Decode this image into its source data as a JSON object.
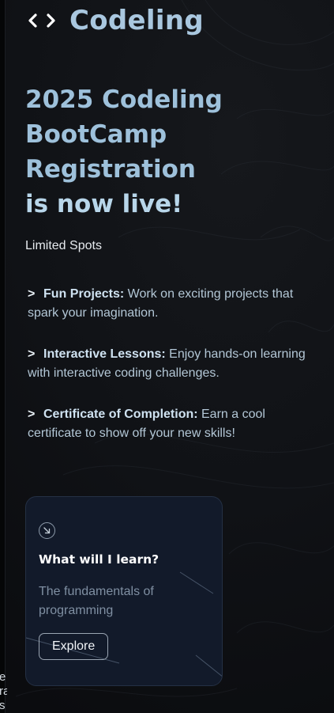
{
  "brand": {
    "icon": "code-brackets-icon",
    "name": "Codeling"
  },
  "hero": {
    "line1": "2025 Codeling",
    "line2": "BootCamp",
    "line3": "Registration",
    "line4": "is now live!"
  },
  "limited_text": "Limited Spots",
  "features": [
    {
      "title": "Fun Projects:",
      "desc": " Work on exciting projects that spark your imagination."
    },
    {
      "title": "Interactive Lessons:",
      "desc": " Enjoy hands-on learning with interactive coding challenges."
    },
    {
      "title": "Certificate of Completion:",
      "desc": " Earn a cool certificate to show off your new skills!"
    }
  ],
  "card": {
    "icon": "arrow-down-right-circle-icon",
    "title": "What will I learn?",
    "description": "The fundamentals of programming",
    "button_label": "Explore"
  },
  "clipped_text": "e\nra\ns",
  "colors": {
    "accent": "#9ec1db",
    "card_bg": "#121a2a",
    "background": "#101216"
  }
}
